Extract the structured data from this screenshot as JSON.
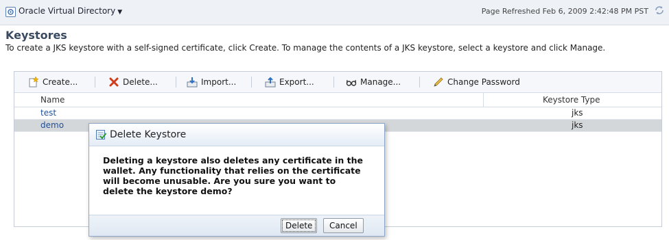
{
  "app": {
    "title": "Oracle Virtual Directory",
    "refreshed": "Page Refreshed Feb 6, 2009 2:42:48 PM PST"
  },
  "page": {
    "title": "Keystores",
    "description": "To create a JKS keystore with a self-signed certificate, click Create. To manage the contents of a JKS keystore, select a keystore and click Manage."
  },
  "toolbar": {
    "create": "Create...",
    "delete": "Delete...",
    "import": "Import...",
    "export": "Export...",
    "manage": "Manage...",
    "change_password": "Change Password"
  },
  "table": {
    "columns": [
      "Name",
      "Keystore Type"
    ],
    "rows": [
      {
        "name": "test",
        "type": "jks"
      },
      {
        "name": "demo",
        "type": "jks"
      }
    ]
  },
  "dialog": {
    "title": "Delete Keystore",
    "message_lines": [
      "Deleting a keystore also deletes any certificate in the",
      "wallet. Any functionality that relies on the certificate",
      "will become unusable. Are you sure you want to",
      "delete the keystore demo?"
    ],
    "delete_label": "Delete",
    "cancel_label": "Cancel"
  },
  "colors": {
    "link": "#1f4f9a",
    "selected_row": "#d4d7da",
    "title": "#3a4a60"
  }
}
